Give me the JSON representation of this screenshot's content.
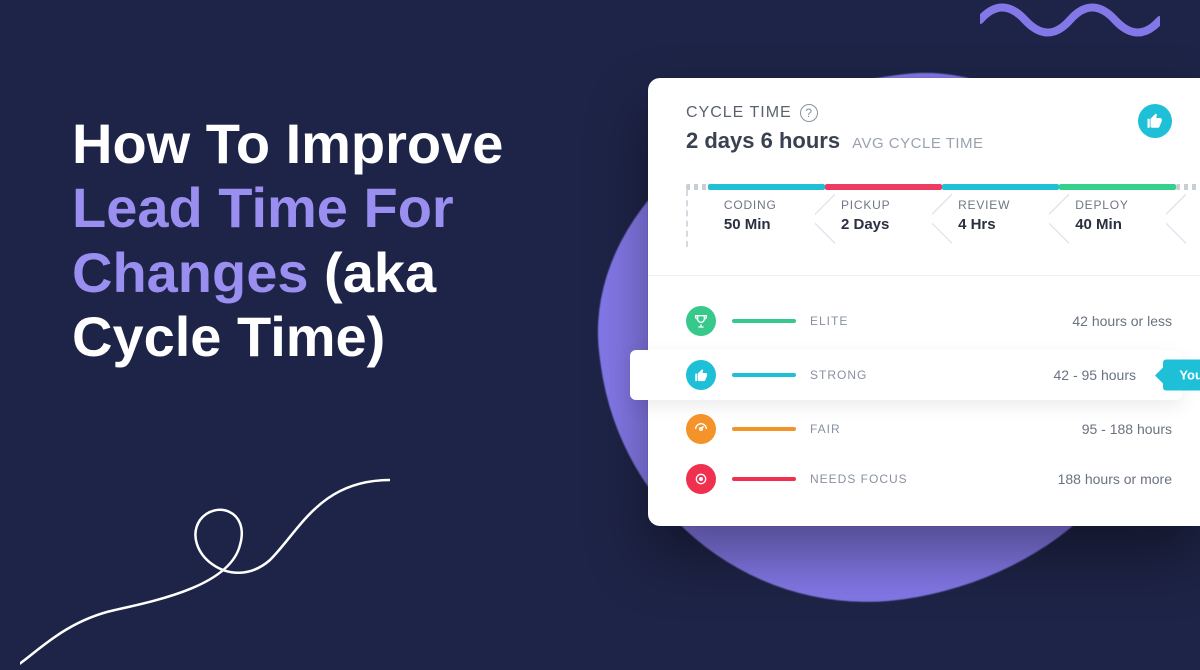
{
  "headline": {
    "part1": "How To Improve",
    "part2": "Lead Time For Changes",
    "part3": " (aka Cycle Time)"
  },
  "card": {
    "title": "CYCLE TIME",
    "avg_value": "2 days 6 hours",
    "avg_label": "AVG CYCLE TIME",
    "stages": [
      {
        "label": "CODING",
        "value": "50",
        "unit": "Min"
      },
      {
        "label": "PICKUP",
        "value": "2",
        "unit": "Days"
      },
      {
        "label": "REVIEW",
        "value": "4",
        "unit": "Hrs"
      },
      {
        "label": "DEPLOY",
        "value": "40",
        "unit": "Min"
      }
    ],
    "benchmarks": [
      {
        "name": "ELITE",
        "range": "42 hours or less"
      },
      {
        "name": "STRONG",
        "range": "42 - 95 hours"
      },
      {
        "name": "FAIR",
        "range": "95 - 188 hours"
      },
      {
        "name": "NEEDS FOCUS",
        "range": "188 hours or more"
      }
    ],
    "your_label": "Your"
  }
}
